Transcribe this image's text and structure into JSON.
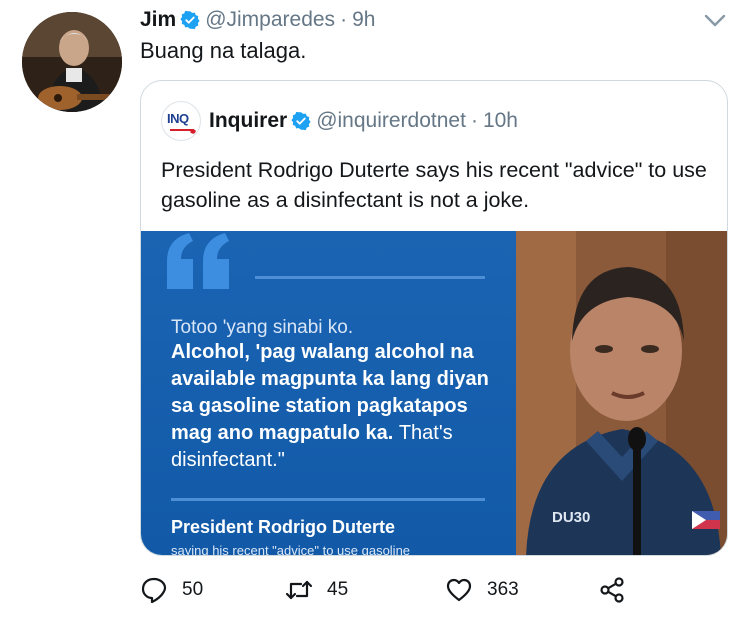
{
  "tweet": {
    "author_name": "Jim",
    "author_handle": "@Jimparedes",
    "separator": "·",
    "time": "9h",
    "text": "Buang na talaga.",
    "avatar_icon": "person-with-guitar-avatar",
    "verified_icon": "verified-badge-icon",
    "menu_icon": "chevron-down-icon"
  },
  "quoted": {
    "logo_text": "INQ",
    "author_name": "Inquirer",
    "author_handle": "@inquirerdotnet",
    "separator": "·",
    "time": "10h",
    "text": "President Rodrigo Duterte says his recent \"advice\" to use gasoline as a disinfectant is not a joke.",
    "image": {
      "intro": "Totoo 'yang sinabi ko.",
      "quote_bold": "Alcohol, 'pag walang alcohol na available magpunta ka lang diyan sa gasoline station pagkatapos mag ano magpatulo ka.",
      "quote_regular": "That's disinfectant.\"",
      "attribution": "President Rodrigo Duterte",
      "caption": "saying his recent \"advice\" to use gasoline",
      "jacket_label": "DU30"
    }
  },
  "actions": {
    "replies": "50",
    "retweets": "45",
    "likes": "363"
  },
  "colors": {
    "verified_blue": "#1da1f2",
    "muted_text": "#657786",
    "panel_blue": "#1a64b3",
    "border": "#cfd9de"
  }
}
